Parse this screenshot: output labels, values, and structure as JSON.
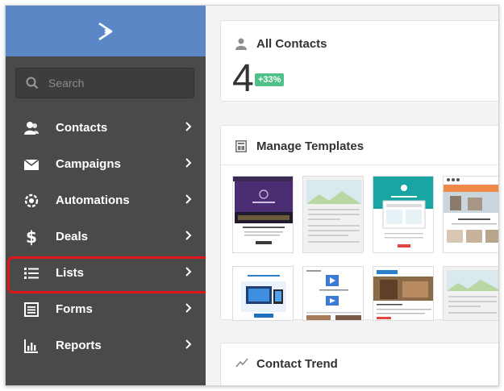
{
  "sidebar": {
    "search_placeholder": "Search",
    "items": [
      {
        "label": "Contacts",
        "icon": "contacts-icon"
      },
      {
        "label": "Campaigns",
        "icon": "envelope-icon"
      },
      {
        "label": "Automations",
        "icon": "automation-gear-icon"
      },
      {
        "label": "Deals",
        "icon": "dollar-icon"
      },
      {
        "label": "Lists",
        "icon": "list-icon"
      },
      {
        "label": "Forms",
        "icon": "form-icon"
      },
      {
        "label": "Reports",
        "icon": "bar-chart-icon"
      }
    ],
    "highlighted_item": "Lists"
  },
  "main": {
    "contacts_card": {
      "title": "All Contacts",
      "count": "4",
      "badge": "+33%"
    },
    "templates_card": {
      "title": "Manage Templates"
    },
    "trend_card": {
      "title": "Contact Trend"
    }
  },
  "colors": {
    "brand": "#5b87c7",
    "sidebar": "#4a4a4a",
    "badge": "#4fc188",
    "highlight": "#e0161b"
  }
}
